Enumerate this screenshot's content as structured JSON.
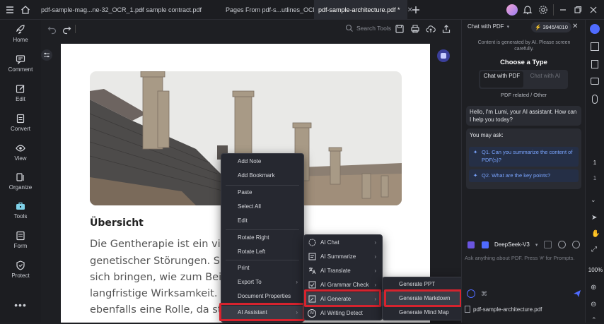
{
  "tabs": [
    {
      "label": "pdf-sample-mag...ne-32_OCR_1.pdf"
    },
    {
      "label": "sample contract.pdf"
    },
    {
      "label": "Pages From pdf-s...utlines_OCR.pdf"
    },
    {
      "label": "pdf-sample-architecture.pdf *"
    }
  ],
  "nav": [
    {
      "label": "Home",
      "icon": "rocket-icon"
    },
    {
      "label": "Comment",
      "icon": "comment-icon"
    },
    {
      "label": "Edit",
      "icon": "edit-icon"
    },
    {
      "label": "Convert",
      "icon": "convert-icon"
    },
    {
      "label": "View",
      "icon": "eye-icon"
    },
    {
      "label": "Organize",
      "icon": "organize-icon"
    },
    {
      "label": "Tools",
      "icon": "toolbox-icon"
    },
    {
      "label": "Form",
      "icon": "form-icon"
    },
    {
      "label": "Protect",
      "icon": "shield-icon"
    }
  ],
  "toolbar": {
    "search_label": "Search Tools"
  },
  "document": {
    "heading": "Übersicht",
    "lines": [
      "Die Gentherapie ist ein vielver",
      "genetischer Störungen. Sie ka",
      "sich bringen, wie zum Beispie",
      "langfristige Wirksamkeit. Regu",
      "ebenfalls eine Rolle, da streng"
    ]
  },
  "context_menu": {
    "items": [
      {
        "label": "Add Note"
      },
      {
        "label": "Add Bookmark"
      },
      {
        "label": "Paste"
      },
      {
        "label": "Select All"
      },
      {
        "label": "Edit"
      },
      {
        "label": "Rotate Right"
      },
      {
        "label": "Rotate Left"
      },
      {
        "label": "Print"
      },
      {
        "label": "Export To",
        "submenu": true
      },
      {
        "label": "Document Properties"
      },
      {
        "label": "AI Assistant",
        "submenu": true
      }
    ]
  },
  "ai_menu": {
    "items": [
      {
        "label": "AI Chat",
        "icon": "chat-bubble-icon"
      },
      {
        "label": "AI Summarize",
        "icon": "summarize-icon"
      },
      {
        "label": "AI Translate",
        "icon": "translate-icon"
      },
      {
        "label": "AI Grammar Check",
        "icon": "grammar-icon"
      },
      {
        "label": "AI Generate",
        "icon": "generate-icon"
      },
      {
        "label": "AI Writing Detect",
        "icon": "ai-detect-icon"
      }
    ]
  },
  "generate_menu": {
    "items": [
      {
        "label": "Generate PPT"
      },
      {
        "label": "Generate Markdown"
      },
      {
        "label": "Generate Mind Map"
      }
    ]
  },
  "panel": {
    "mode": "Chat with PDF",
    "credits": "3945/4010",
    "notice": "Content is generated by AI. Please screen carefully.",
    "choose_type": "Choose a Type",
    "type_pdf": "Chat with PDF",
    "type_ai": "Chat with AI",
    "related": "PDF related / Other",
    "greeting": "Hello, I'm Lumi, your AI assistant. How can I help you today?",
    "you_may_ask": "You may ask:",
    "q1": "Q1. Can you summarize the content of PDF(s)?",
    "q2": "Q2. What are the key points?",
    "model": "DeepSeek-V3",
    "input_placeholder": "Ask anything about PDF. Press '#' for Prompts.",
    "attached_file": "pdf-sample-architecture.pdf"
  },
  "right_sidebar": {
    "page_current": "1",
    "page_total": "1",
    "zoom": "100%"
  },
  "colors": {
    "accent": "#4f6bff",
    "highlight_red": "#d6232e",
    "suggest_text": "#7aa5ff"
  }
}
